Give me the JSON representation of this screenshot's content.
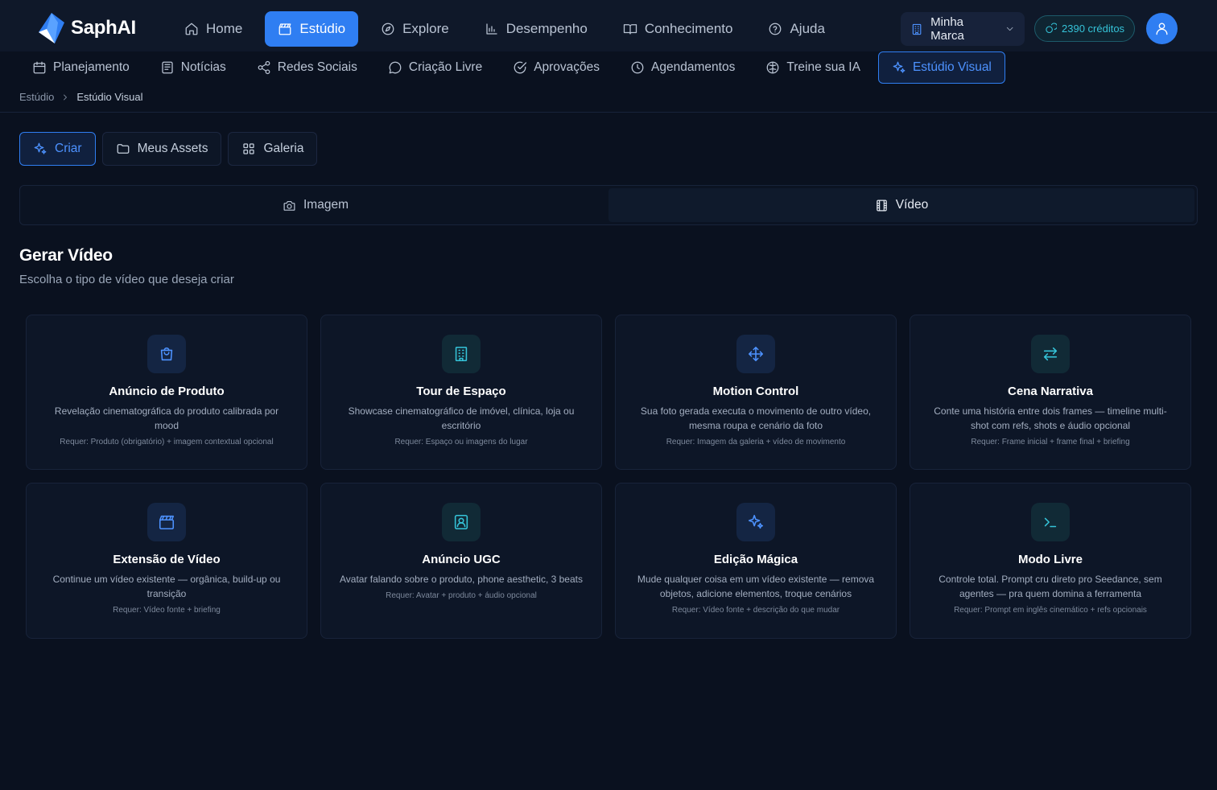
{
  "app": {
    "name": "SaphAI"
  },
  "main_nav": [
    {
      "label": "Home",
      "icon": "home-icon",
      "active": false
    },
    {
      "label": "Estúdio",
      "icon": "clapperboard-icon",
      "active": true
    },
    {
      "label": "Explore",
      "icon": "compass-icon",
      "active": false
    },
    {
      "label": "Desempenho",
      "icon": "bar-chart-icon",
      "active": false
    },
    {
      "label": "Conhecimento",
      "icon": "book-open-icon",
      "active": false
    },
    {
      "label": "Ajuda",
      "icon": "help-circle-icon",
      "active": false
    }
  ],
  "brand_select": {
    "label": "Minha Marca",
    "icon": "building-icon"
  },
  "credits": {
    "label": "2390 créditos",
    "icon": "coins-icon"
  },
  "sub_nav": [
    {
      "label": "Planejamento",
      "icon": "calendar-icon",
      "active": false
    },
    {
      "label": "Notícias",
      "icon": "newspaper-icon",
      "active": false
    },
    {
      "label": "Redes Sociais",
      "icon": "share-icon",
      "active": false
    },
    {
      "label": "Criação Livre",
      "icon": "message-circle-icon",
      "active": false
    },
    {
      "label": "Aprovações",
      "icon": "check-circle-icon",
      "active": false
    },
    {
      "label": "Agendamentos",
      "icon": "clock-icon",
      "active": false
    },
    {
      "label": "Treine sua IA",
      "icon": "brain-icon",
      "active": false
    },
    {
      "label": "Estúdio Visual",
      "icon": "sparkles-icon",
      "active": true
    }
  ],
  "breadcrumb": {
    "root": "Estúdio",
    "current": "Estúdio Visual"
  },
  "mode_tabs": [
    {
      "label": "Criar",
      "icon": "sparkles-icon",
      "active": true
    },
    {
      "label": "Meus Assets",
      "icon": "folder-icon",
      "active": false
    },
    {
      "label": "Galeria",
      "icon": "grid-icon",
      "active": false
    }
  ],
  "media_toggle": [
    {
      "label": "Imagem",
      "icon": "camera-icon",
      "active": false
    },
    {
      "label": "Vídeo",
      "icon": "film-icon",
      "active": true
    }
  ],
  "section": {
    "title": "Gerar Vídeo",
    "subtitle": "Escolha o tipo de vídeo que deseja criar"
  },
  "cards": [
    {
      "title": "Anúncio de Produto",
      "desc": "Revelação cinematográfica do produto calibrada por mood",
      "req": "Requer: Produto (obrigatório) + imagem contextual opcional",
      "icon": "shopping-bag-icon",
      "tone": "blue"
    },
    {
      "title": "Tour de Espaço",
      "desc": "Showcase cinematográfico de imóvel, clínica, loja ou escritório",
      "req": "Requer: Espaço ou imagens do lugar",
      "icon": "building-icon",
      "tone": "teal"
    },
    {
      "title": "Motion Control",
      "desc": "Sua foto gerada executa o movimento de outro vídeo, mesma roupa e cenário da foto",
      "req": "Requer: Imagem da galeria + vídeo de movimento",
      "icon": "move-icon",
      "tone": "blue"
    },
    {
      "title": "Cena Narrativa",
      "desc": "Conte uma história entre dois frames — timeline multi-shot com refs, shots e áudio opcional",
      "req": "Requer: Frame inicial + frame final + briefing",
      "icon": "arrows-left-right-icon",
      "tone": "teal"
    },
    {
      "title": "Extensão de Vídeo",
      "desc": "Continue um vídeo existente — orgânica, build-up ou transição",
      "req": "Requer: Vídeo fonte + briefing",
      "icon": "clapperboard-icon",
      "tone": "blue"
    },
    {
      "title": "Anúncio UGC",
      "desc": "Avatar falando sobre o produto, phone aesthetic, 3 beats",
      "req": "Requer: Avatar + produto + áudio opcional",
      "icon": "user-square-icon",
      "tone": "teal"
    },
    {
      "title": "Edição Mágica",
      "desc": "Mude qualquer coisa em um vídeo existente — remova objetos, adicione elementos, troque cenários",
      "req": "Requer: Vídeo fonte + descrição do que mudar",
      "icon": "sparkles-icon",
      "tone": "blue"
    },
    {
      "title": "Modo Livre",
      "desc": "Controle total. Prompt cru direto pro Seedance, sem agentes — pra quem domina a ferramenta",
      "req": "Requer: Prompt em inglês cinemático + refs opcionais",
      "icon": "terminal-icon",
      "tone": "teal"
    }
  ]
}
